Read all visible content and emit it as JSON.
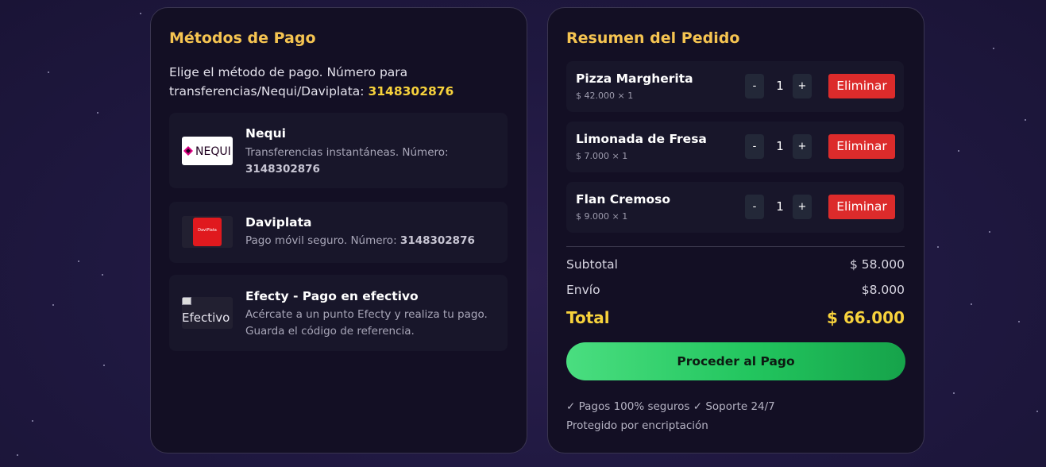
{
  "payment_methods": {
    "title": "Métodos de Pago",
    "intro_text": "Elige el método de pago. Número para transferencias/Nequi/Daviplata:",
    "intro_number": "3148302876",
    "methods": [
      {
        "name": "Nequi",
        "description": "Transferencias instantáneas. Número:",
        "number": "3148302876",
        "logo_text": "NEQUI",
        "logo_icon": "nequi-logo-icon"
      },
      {
        "name": "Daviplata",
        "description": "Pago móvil seguro. Número:",
        "number": "3148302876",
        "logo_text": "DaviPlata",
        "logo_icon": "daviplata-logo-icon"
      },
      {
        "name": "Efecty - Pago en efectivo",
        "description": "Acércate a un punto Efecty y realiza tu pago. Guarda el código de referencia.",
        "logo_alt": "Efectivo",
        "logo_icon": "broken-image-icon"
      }
    ]
  },
  "order_summary": {
    "title": "Resumen del Pedido",
    "items": [
      {
        "name": "Pizza Margherita",
        "price_line": "$ 42.000 × 1",
        "quantity": "1",
        "minus_label": "-",
        "plus_label": "+",
        "remove_label": "Eliminar"
      },
      {
        "name": "Limonada de Fresa",
        "price_line": "$ 7.000 × 1",
        "quantity": "1",
        "minus_label": "-",
        "plus_label": "+",
        "remove_label": "Eliminar"
      },
      {
        "name": "Flan Cremoso",
        "price_line": "$ 9.000 × 1",
        "quantity": "1",
        "minus_label": "-",
        "plus_label": "+",
        "remove_label": "Eliminar"
      }
    ],
    "subtotal_label": "Subtotal",
    "subtotal_value": "$ 58.000",
    "shipping_label": "Envío",
    "shipping_value": "$8.000",
    "total_label": "Total",
    "total_value": "$ 66.000",
    "checkout_label": "Proceder al Pago",
    "security_note": "✓ Pagos 100% seguros ✓ Soporte 24/7",
    "encryption_note": "Protegido por encriptación"
  },
  "colors": {
    "accent_gold": "#f5c451",
    "highlight_yellow": "#f7d23c",
    "danger_red": "#dc2b2b",
    "success_green": "#22c55e",
    "card_bg": "#130f24",
    "page_bg": "#1f1840"
  }
}
